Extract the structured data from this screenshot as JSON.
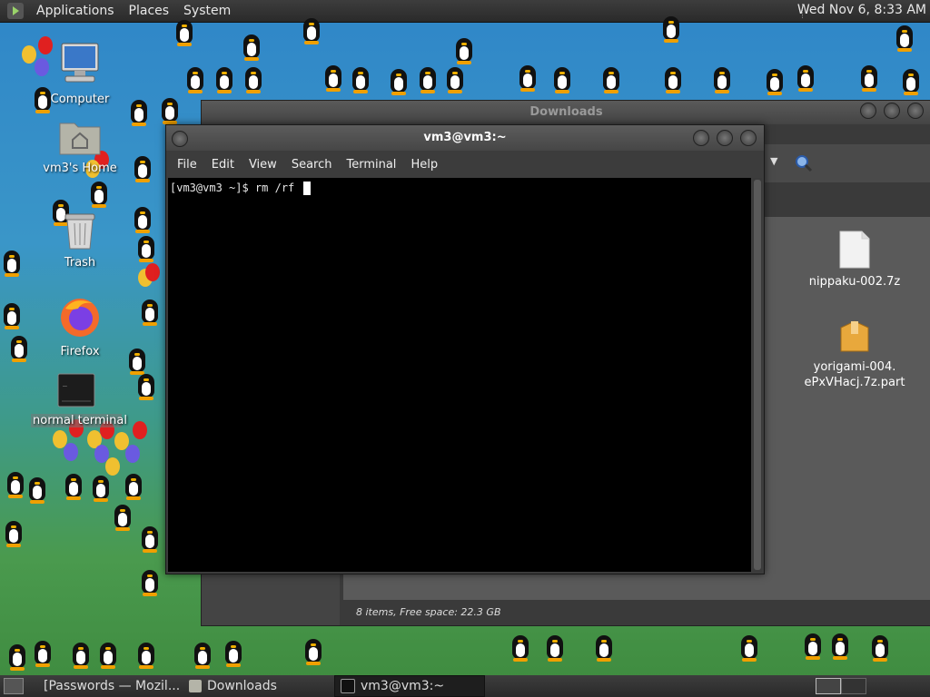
{
  "top_panel": {
    "menus": [
      "Applications",
      "Places",
      "System"
    ],
    "clock": "Wed Nov 6,  8:33 AM"
  },
  "desktop_icons": [
    {
      "label": "Computer",
      "icon": "computer-icon"
    },
    {
      "label": "vm3's Home",
      "icon": "home-folder-icon"
    },
    {
      "label": "Trash",
      "icon": "trash-icon"
    },
    {
      "label": "Firefox",
      "icon": "firefox-icon"
    },
    {
      "label": "normal terminal",
      "icon": "terminal-icon"
    }
  ],
  "file_manager": {
    "title": "Downloads",
    "status": "8 items, Free space: 22.3 GB",
    "files": [
      {
        "name": "nippaku-002.7z",
        "icon": "file-icon"
      },
      {
        "name": "yorigami-004.ePxVHacj.7z.part",
        "line1": "yorigami-004.",
        "line2": "ePxVHacj.7z.part",
        "icon": "package-icon"
      }
    ]
  },
  "terminal": {
    "title": "vm3@vm3:~",
    "menu": [
      "File",
      "Edit",
      "View",
      "Search",
      "Terminal",
      "Help"
    ],
    "prompt": "[vm3@vm3 ~]$ rm /rf "
  },
  "taskbar": [
    {
      "label": "[Passwords — Mozil...",
      "icon": "firefox-icon",
      "active": false
    },
    {
      "label": "Downloads",
      "icon": "folder-icon",
      "active": false
    },
    {
      "label": "vm3@vm3:~",
      "icon": "terminal-icon",
      "active": true
    }
  ],
  "colors": {
    "panel": "#2e2e2e",
    "terminal_bg": "#000000",
    "firefox_orange": "#f46a2a"
  }
}
